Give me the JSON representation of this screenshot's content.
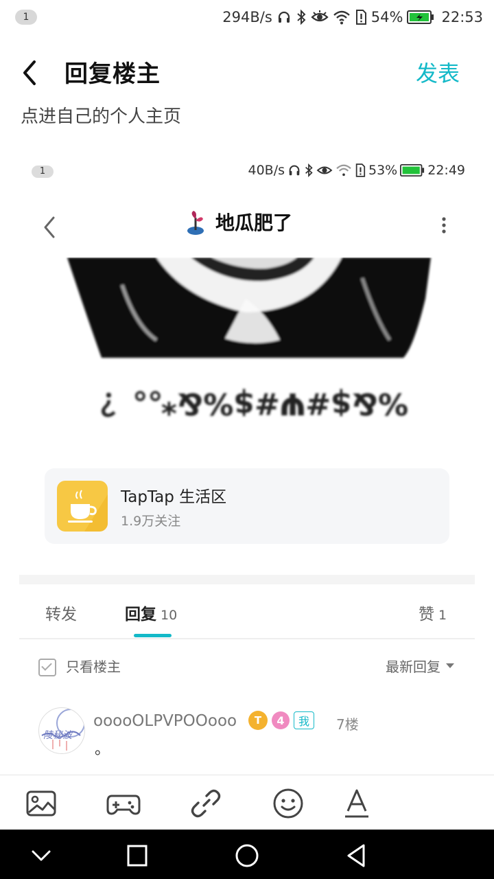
{
  "status": {
    "badge": "1",
    "speed": "294B/s",
    "battery": "54%",
    "time": "22:53",
    "icons": [
      "headphones-icon",
      "bluetooth-icon",
      "eye-icon",
      "wifi-icon",
      "alert-sim-icon",
      "battery-charging-icon"
    ]
  },
  "header": {
    "back_icon": "back-arrow-icon",
    "title": "回复楼主",
    "publish": "发表"
  },
  "editor": {
    "cut_text": "点进自己的个人主页"
  },
  "screenshot": {
    "status": {
      "badge": "1",
      "speed": "40B/s",
      "battery": "53%",
      "time": "22:49"
    },
    "header": {
      "title": "地瓜肥了",
      "title_icon": "sprout-icon"
    },
    "meme_text": "%&$#Ψ#$%&*。。？",
    "forum": {
      "name": "TapTap 生活区",
      "followers": "1.9万关注",
      "icon": "coffee-cup-icon"
    },
    "tabs": {
      "repost": "转发",
      "reply": "回复",
      "reply_count": "10",
      "like": "赞",
      "like_count": "1"
    },
    "filter": {
      "only_op": "只看楼主",
      "sort": "最新回复"
    },
    "reply": {
      "username": "ooooOLPVPOOooo",
      "badge_t": "T",
      "level": "4",
      "me": "我",
      "floor": "7楼",
      "content": "。"
    }
  },
  "toolbar": {
    "icons": [
      "image-icon",
      "gamepad-icon",
      "link-icon",
      "emoji-icon",
      "text-format-icon"
    ]
  },
  "navbar": {
    "icons": [
      "nav-collapse-icon",
      "nav-recents-icon",
      "nav-home-icon",
      "nav-back-icon"
    ]
  },
  "colors": {
    "accent": "#14b9c8",
    "badge_gold": "#f4b22f",
    "badge_pink": "#f08ac0",
    "forum_icon": "#f7c844"
  }
}
